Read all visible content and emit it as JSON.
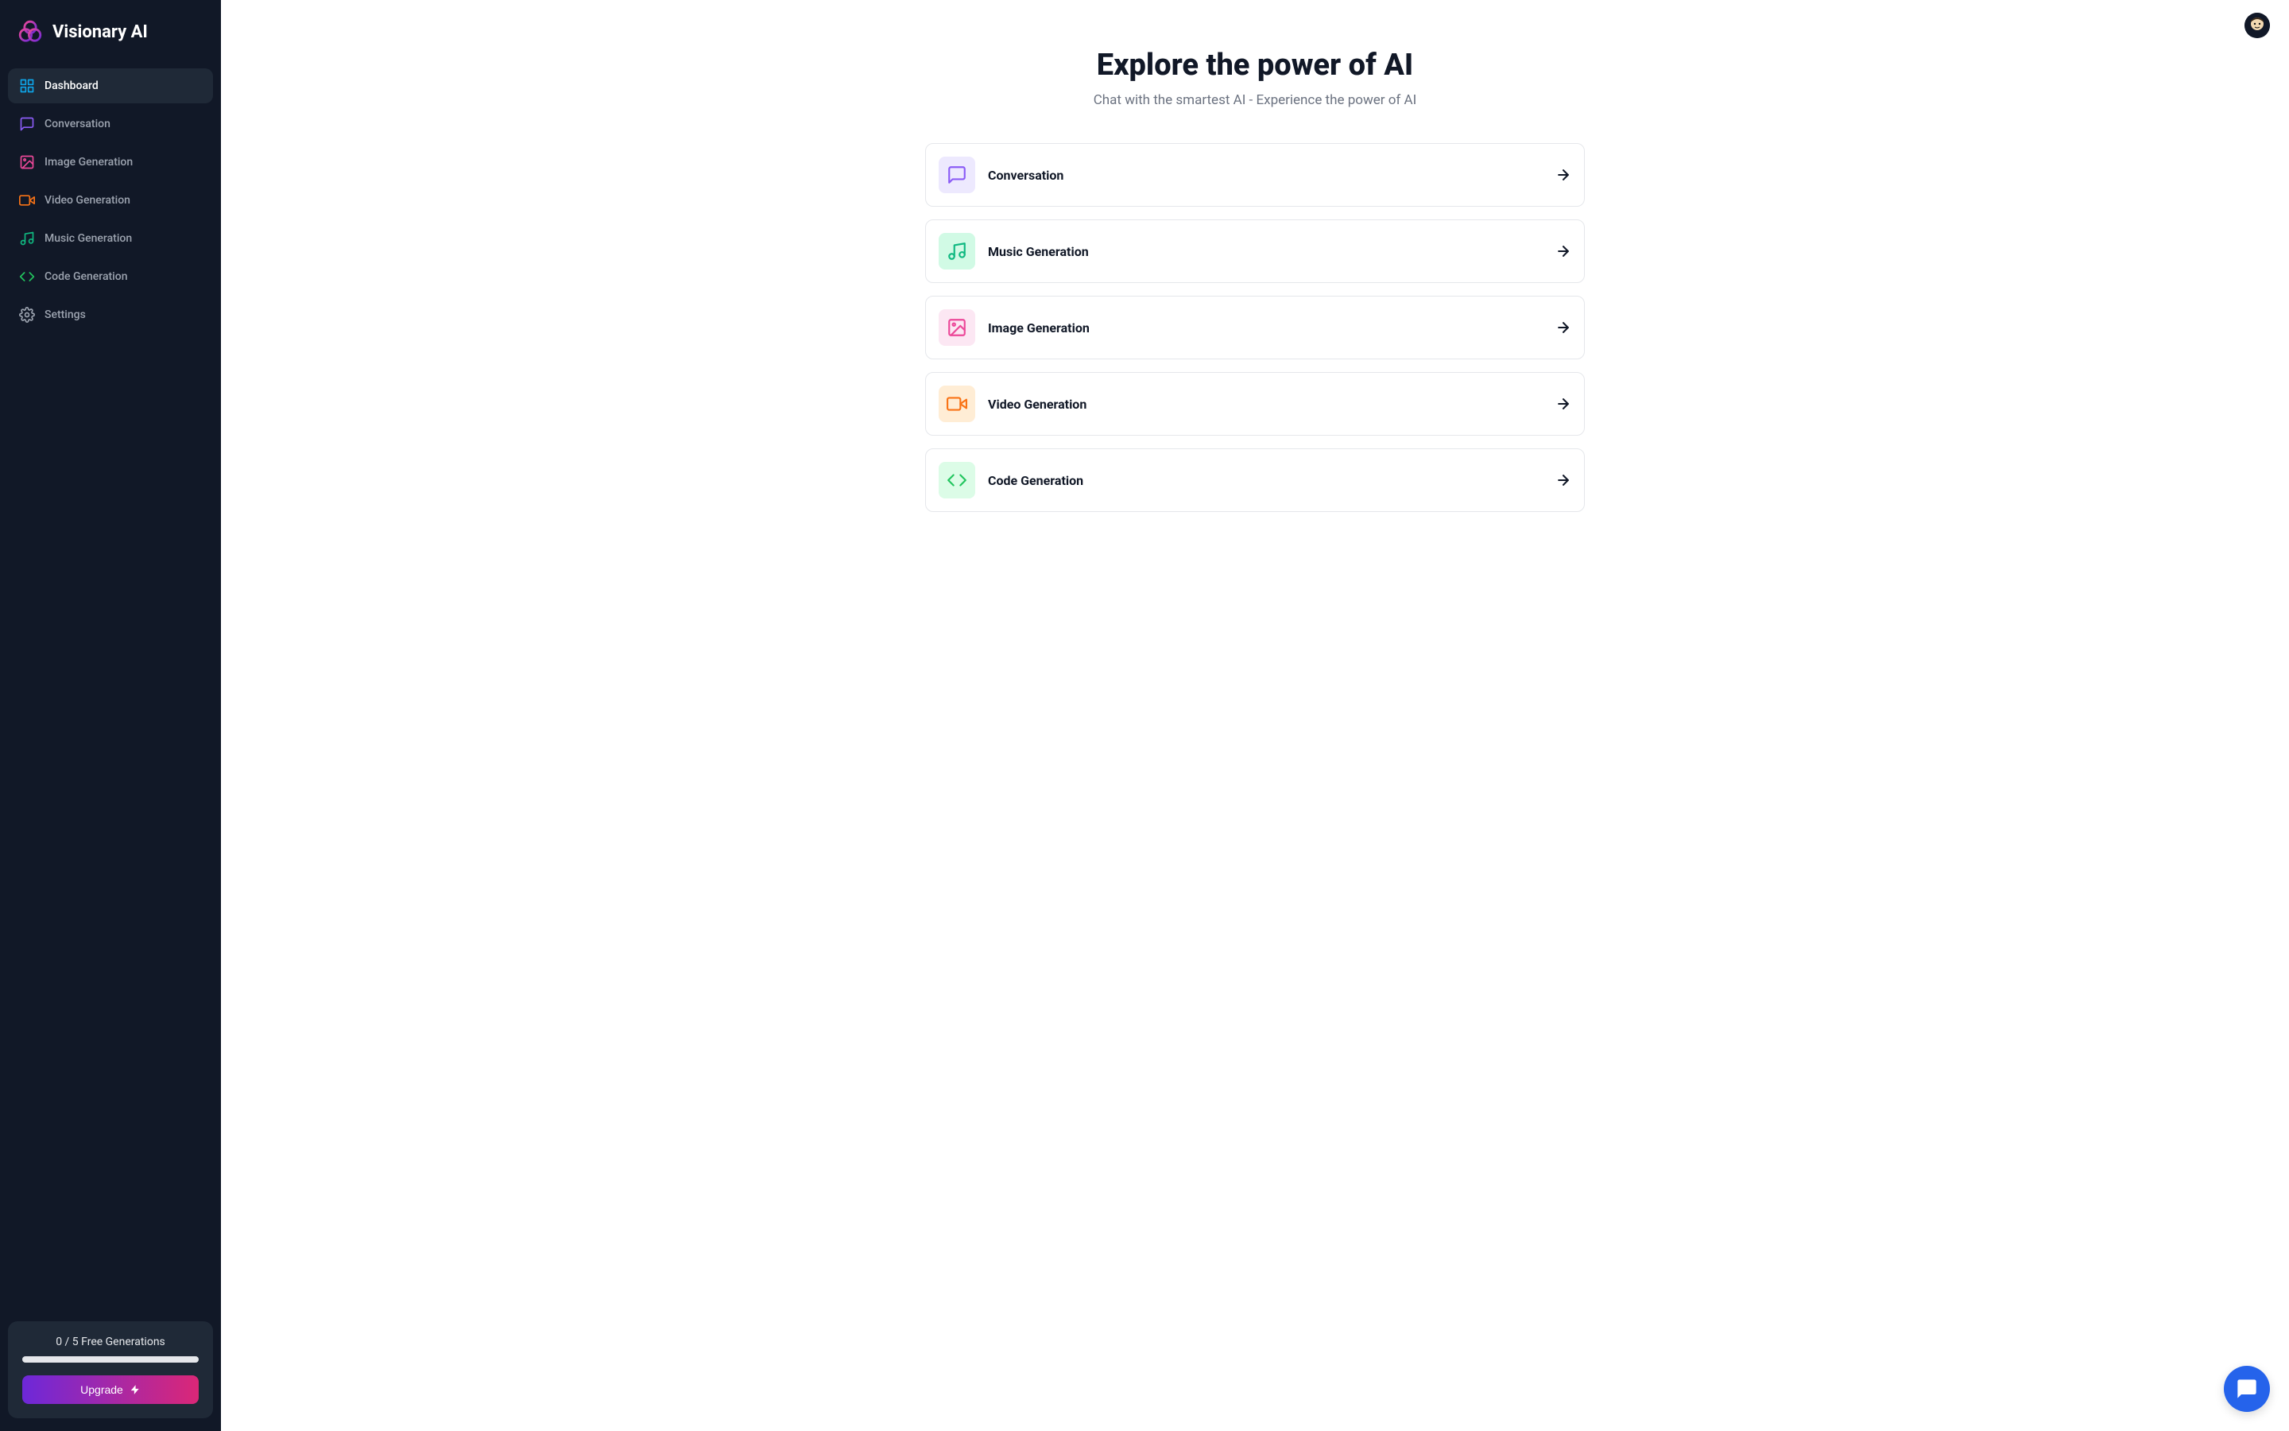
{
  "brand": {
    "name": "Visionary AI"
  },
  "sidebar": {
    "items": [
      {
        "label": "Dashboard",
        "icon": "dashboard",
        "color": "#0ea5e9",
        "active": true
      },
      {
        "label": "Conversation",
        "icon": "chat",
        "color": "#8b5cf6",
        "active": false
      },
      {
        "label": "Image Generation",
        "icon": "image",
        "color": "#ec4899",
        "active": false
      },
      {
        "label": "Video Generation",
        "icon": "video",
        "color": "#f97316",
        "active": false
      },
      {
        "label": "Music Generation",
        "icon": "music",
        "color": "#10b981",
        "active": false
      },
      {
        "label": "Code Generation",
        "icon": "code",
        "color": "#22c55e",
        "active": false
      },
      {
        "label": "Settings",
        "icon": "settings",
        "color": "#9ca3af",
        "active": false
      }
    ],
    "footer": {
      "generations_text": "0 / 5 Free Generations",
      "upgrade_label": "Upgrade"
    }
  },
  "main": {
    "title": "Explore the power of AI",
    "subtitle": "Chat with the smartest AI - Experience the power of AI",
    "cards": [
      {
        "label": "Conversation",
        "icon": "chat",
        "bg": "#ede9fe",
        "color": "#8b5cf6"
      },
      {
        "label": "Music Generation",
        "icon": "music",
        "bg": "#d1fae5",
        "color": "#10b981"
      },
      {
        "label": "Image Generation",
        "icon": "image",
        "bg": "#fce7f3",
        "color": "#ec4899"
      },
      {
        "label": "Video Generation",
        "icon": "video",
        "bg": "#ffedd5",
        "color": "#f97316"
      },
      {
        "label": "Code Generation",
        "icon": "code",
        "bg": "#dcfce7",
        "color": "#22c55e"
      }
    ]
  }
}
